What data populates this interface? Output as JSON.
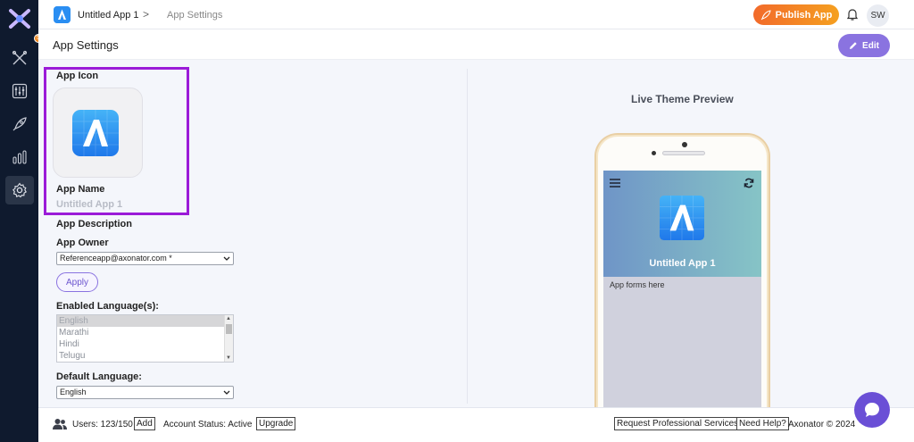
{
  "topbar": {
    "app_name": "Untitled App 1",
    "separator": ">",
    "current_page": "App Settings",
    "publish_label": "Publish App",
    "avatar_initials": "SW"
  },
  "sidebar": {
    "notification_count": "5",
    "items": [
      {
        "icon": "tools-icon"
      },
      {
        "icon": "sliders-icon"
      },
      {
        "icon": "rocket-icon"
      },
      {
        "icon": "bar-chart-icon"
      },
      {
        "icon": "gear-icon",
        "active": true
      }
    ]
  },
  "page": {
    "title": "App Settings",
    "edit_label": "Edit"
  },
  "settings": {
    "app_icon_label": "App Icon",
    "app_name_label": "App Name",
    "app_name_value": "Untitled App 1",
    "app_description_label": "App Description",
    "app_owner_label": "App Owner",
    "app_owner_value": "Referenceapp@axonator.com *",
    "apply_label": "Apply",
    "enabled_languages_label": "Enabled Language(s):",
    "languages": [
      "English",
      "Marathi",
      "Hindi",
      "Telugu"
    ],
    "default_language_label": "Default Language:",
    "default_language_value": "English"
  },
  "preview": {
    "title": "Live Theme Preview",
    "app_name": "Untitled App 1",
    "body_text": "App forms here"
  },
  "footer": {
    "users_text": "Users: 123/150",
    "add_label": "Add",
    "account_status": "Account Status: Active",
    "upgrade_label": "Upgrade",
    "professional_services_label": "Request Professional Services",
    "help_label": "Need Help?",
    "copyright": "Axonator © 2024"
  },
  "colors": {
    "sidebar_bg": "#0f1a2e",
    "accent": "#8a73e0",
    "publish_gradient_start": "#f26a2a",
    "publish_gradient_end": "#f5a020",
    "highlight_border": "#9b1bd8"
  }
}
